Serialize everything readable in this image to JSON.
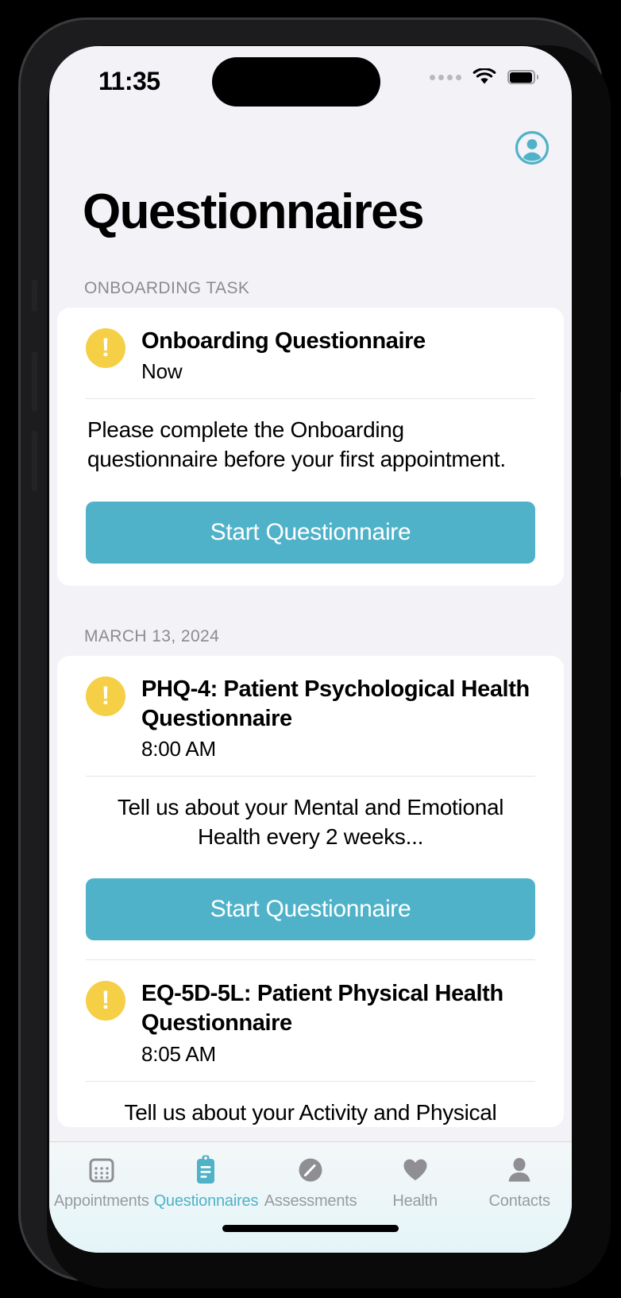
{
  "status_bar": {
    "time": "11:35",
    "signal_icon": "signal-dots-icon",
    "wifi_icon": "wifi-icon",
    "battery_icon": "battery-icon"
  },
  "header": {
    "title": "Questionnaires",
    "avatar_icon": "account-circle-icon"
  },
  "colors": {
    "accent_teal": "#4fb2c9",
    "warning_yellow": "#f5cf45",
    "screen_background": "#f2f2f7",
    "card_background": "#ffffff",
    "muted_text": "#8b8b90",
    "tab_inactive": "#9a9a9f"
  },
  "sections": [
    {
      "header": "ONBOARDING TASK",
      "items": [
        {
          "status_icon": "warning-exclamation-icon",
          "title": "Onboarding Questionnaire",
          "time": "Now",
          "description": "Please complete the Onboarding questionnaire before your first appointment.",
          "description_align": "left",
          "button_label": "Start Questionnaire"
        }
      ]
    },
    {
      "header": "MARCH 13, 2024",
      "items": [
        {
          "status_icon": "warning-exclamation-icon",
          "title": "PHQ-4: Patient Psychological Health Questionnaire",
          "time": "8:00 AM",
          "description": "Tell us about your Mental and Emotional Health every 2 weeks...",
          "description_align": "center",
          "button_label": "Start Questionnaire"
        },
        {
          "status_icon": "warning-exclamation-icon",
          "title": "EQ-5D-5L: Patient Physical Health Questionnaire",
          "time": "8:05 AM",
          "description": "Tell us about your Activity and Physical",
          "description_align": "center",
          "button_label": ""
        }
      ]
    }
  ],
  "tab_bar": {
    "tabs": [
      {
        "label": "Appointments",
        "icon": "calendar-icon",
        "active": false
      },
      {
        "label": "Questionnaires",
        "icon": "clipboard-icon",
        "active": true
      },
      {
        "label": "Assessments",
        "icon": "pencil-circle-icon",
        "active": false
      },
      {
        "label": "Health",
        "icon": "heart-icon",
        "active": false
      },
      {
        "label": "Contacts",
        "icon": "person-icon",
        "active": false
      }
    ]
  }
}
